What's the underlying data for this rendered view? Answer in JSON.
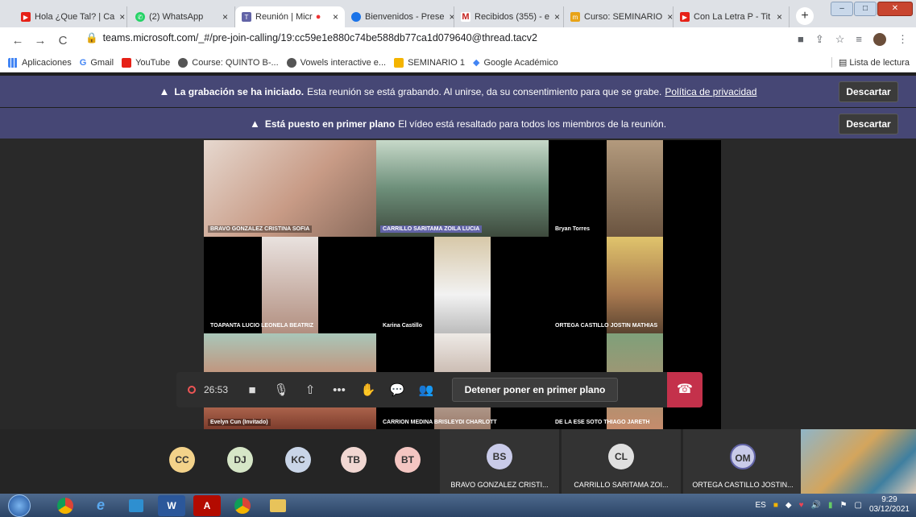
{
  "tabs": [
    {
      "label": "Hola ¿Que Tal? | Ca",
      "color": "#e62117"
    },
    {
      "label": "(2) WhatsApp",
      "color": "#25d366"
    },
    {
      "label": "Reunión | Micr",
      "color": "#6264a7"
    },
    {
      "label": "Bienvenidos - Prese",
      "color": "#1a73e8"
    },
    {
      "label": "Recibidos (355) - e",
      "color": "#c5221f"
    },
    {
      "label": "Curso: SEMINARIO",
      "color": "#e8a317"
    },
    {
      "label": "Con La Letra P - Tit",
      "color": "#e62117"
    }
  ],
  "address": {
    "url": "teams.microsoft.com/_#/pre-join-calling/19:cc59e1e880c74be588db77ca1d079640@thread.tacv2"
  },
  "bookmarks": [
    {
      "label": "Aplicaciones",
      "color": "#4285f4"
    },
    {
      "label": "Gmail",
      "color": "#ea4335"
    },
    {
      "label": "YouTube",
      "color": "#e62117"
    },
    {
      "label": "Course: QUINTO B-...",
      "color": "#555555"
    },
    {
      "label": "Vowels interactive e...",
      "color": "#555555"
    },
    {
      "label": "SEMINARIO 1",
      "color": "#f4b400"
    },
    {
      "label": "Google Académico",
      "color": "#4285f4"
    }
  ],
  "reading_list": "Lista de lectura",
  "banner1": {
    "bold": "La grabación se ha iniciado.",
    "text": "Esta reunión se está grabando. Al unirse, da su consentimiento para que se grabe.",
    "link": "Política de privacidad",
    "button": "Descartar"
  },
  "banner2": {
    "bold": "Está puesto en primer plano",
    "text": "El vídeo está resaltado para todos los miembros de la reunión.",
    "button": "Descartar"
  },
  "participants": [
    "BRAVO GONZALEZ CRISTINA SOFIA",
    "CARRILLO SARITAMA ZOILA LUCIA",
    "Bryan Torres",
    "TOAPANTA LUCIO LEONELA BEATRIZ",
    "Karina Castillo",
    "ORTEGA CASTILLO JOSTIN MATHIAS",
    "Evelyn Cun (Invitado)",
    "CARRION MEDINA BRISLEYDI CHARLOTT",
    "DE LA ESE SOTO THIAGO JARETH"
  ],
  "toolbar": {
    "timer": "26:53",
    "stop_spotlight": "Detener poner en primer plano"
  },
  "avatars": [
    {
      "initials": "CC",
      "color": "#f3d28a"
    },
    {
      "initials": "DJ",
      "color": "#d6e6c7"
    },
    {
      "initials": "KC",
      "color": "#c9d5e8"
    },
    {
      "initials": "TB",
      "color": "#f1d7d2"
    },
    {
      "initials": "BT",
      "color": "#f4c6c2"
    }
  ],
  "strip_people": [
    {
      "initials": "BS",
      "name": "BRAVO GONZALEZ CRISTI...",
      "color": "#c9cbe9"
    },
    {
      "initials": "CL",
      "name": "CARRILLO SARITAMA ZOI...",
      "color": "#e0e0e0"
    },
    {
      "initials": "OM",
      "name": "ORTEGA CASTILLO JOSTIN...",
      "color": "#c9cbe9"
    }
  ],
  "taskbar": {
    "lang": "ES",
    "time": "9:29",
    "date": "03/12/2021"
  }
}
